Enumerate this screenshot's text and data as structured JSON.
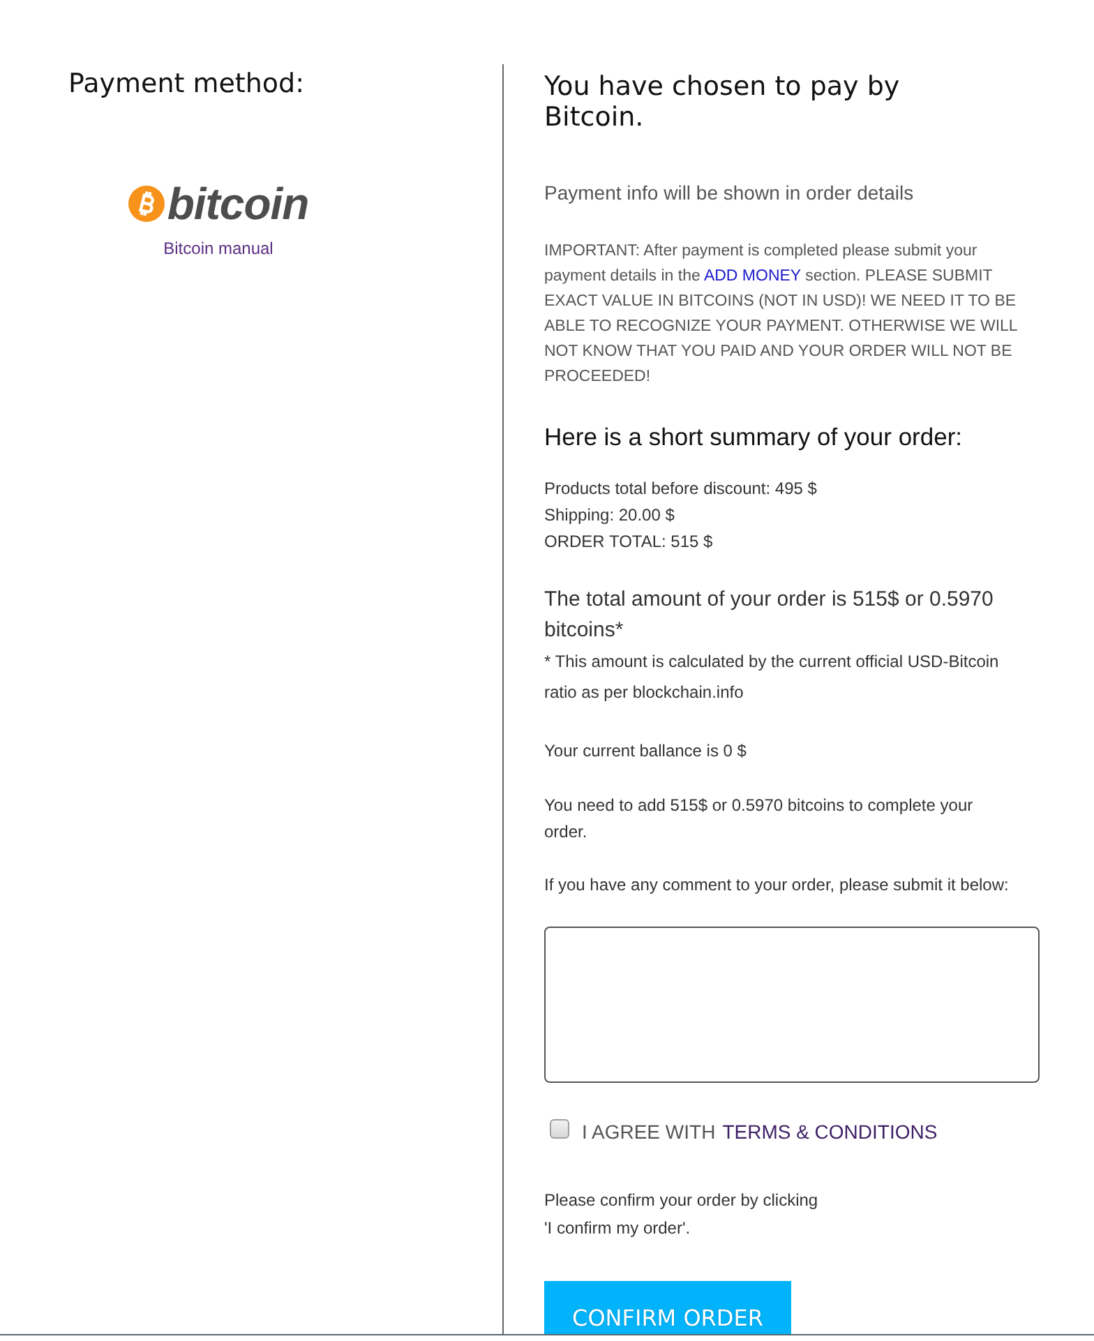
{
  "payment_method": {
    "heading": "Payment method:",
    "logo_text": "bitcoin",
    "manual_link": "Bitcoin manual"
  },
  "order": {
    "heading": "You have chosen to pay by Bitcoin.",
    "info": "Payment info will be shown in order details",
    "notice": {
      "before": "IMPORTANT: After payment is completed please submit your payment details in the",
      "link": "ADD MONEY",
      "after": "section. PLEASE SUBMIT EXACT VALUE IN BITCOINS (NOT IN USD)! WE NEED IT TO BE ABLE TO RECOGNIZE YOUR PAYMENT. OTHERWISE WE WILL NOT KNOW THAT YOU PAID AND YOUR ORDER WILL NOT BE PROCEEDED!"
    },
    "summary_heading": "Here is a short summary of your order:",
    "summary_lines": [
      "Products total before discount: 495 $",
      "Shipping: 20.00 $",
      "ORDER TOTAL: 515 $"
    ],
    "total_amount": "The total amount of your order is 515$ or 0.5970 bitcoins*",
    "footnote": "* This amount is calculated by the current official USD-Bitcoin ratio as per blockchain.info",
    "balance": "Your current ballance is 0 $",
    "need_to_add": "You need to add 515$ or 0.5970 bitcoins to complete your order.",
    "comment_prompt": "If you have any comment to your order, please submit it below:",
    "agreement": {
      "checked": false,
      "label": "I AGREE WITH",
      "link": "TERMS & CONDITIONS"
    },
    "confirm_hint": [
      "Please confirm your order by clicking",
      "'I confirm my order'."
    ],
    "confirm_button": "CONFIRM ORDER"
  }
}
